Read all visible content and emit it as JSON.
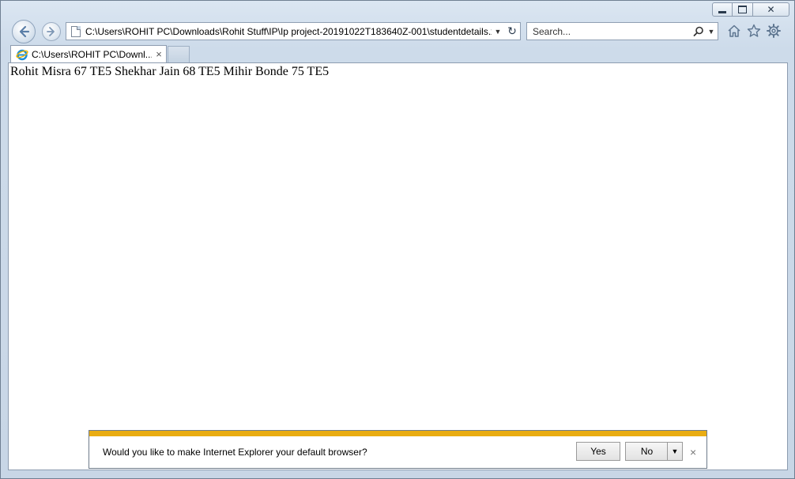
{
  "browser": {
    "address_url": "C:\\Users\\ROHIT PC\\Downloads\\Rohit Stuff\\IP\\Ip project-20191022T183640Z-001\\studentdetails.xı",
    "search_placeholder": "Search...",
    "tab_title": "C:\\Users\\ROHIT PC\\Downl...",
    "tab_close_glyph": "×",
    "caption": {
      "close_glyph": "✕"
    }
  },
  "page": {
    "content_text": "Rohit Misra 67 TE5 Shekhar Jain 68 TE5 Mihir Bonde 75 TE5"
  },
  "notification": {
    "message": "Would you like to make Internet Explorer your default browser?",
    "yes_label": "Yes",
    "no_label": "No",
    "close_glyph": "×",
    "accent_color": "#e9ac12"
  },
  "icons": {
    "back": "back-arrow-icon",
    "forward": "forward-arrow-icon",
    "home": "home-icon",
    "favorites": "star-icon",
    "tools": "gear-icon",
    "ie": "ie-logo-icon"
  }
}
